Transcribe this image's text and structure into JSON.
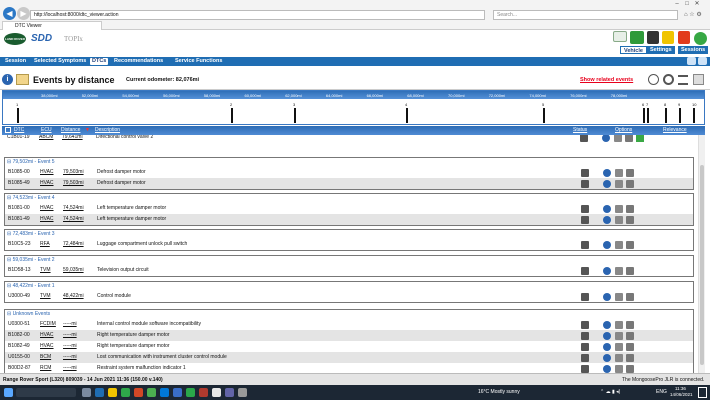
{
  "browser": {
    "url": "http://localhost:8000/dtc_viewer.action",
    "search_placeholder": "Search...",
    "tab_title": "DTC Viewer"
  },
  "app": {
    "logo_text": "LAND ROVER",
    "sdd": "SDD",
    "topix": "TOPIx",
    "top_buttons": [
      "Vehicle",
      "Settings",
      "Sessions"
    ]
  },
  "menu": [
    "Session",
    "Selected Symptoms",
    "DTCs",
    "Recommendations",
    "Service Functions"
  ],
  "events_bar": {
    "title": "Events by distance",
    "odometer": "Current odometer: 82,076mi",
    "related_link": "Show related events"
  },
  "timeline": {
    "ticks": [
      "38,000mi",
      "52,000mi",
      "54,000mi",
      "56,000mi",
      "58,000mi",
      "60,000mi",
      "62,000mi",
      "64,000mi",
      "66,000mi",
      "68,000mi",
      "70,000mi",
      "72,000mi",
      "74,000mi",
      "76,000mi",
      "78,000mi"
    ],
    "markers": [
      {
        "label": "1",
        "pos": 0.02
      },
      {
        "label": "2",
        "pos": 0.325
      },
      {
        "label": "3",
        "pos": 0.415
      },
      {
        "label": "4",
        "pos": 0.575
      },
      {
        "label": "5",
        "pos": 0.77
      },
      {
        "label": "6",
        "pos": 0.913
      },
      {
        "label": "7",
        "pos": 0.918
      },
      {
        "label": "8",
        "pos": 0.945
      },
      {
        "label": "9",
        "pos": 0.965
      },
      {
        "label": "10",
        "pos": 0.985
      }
    ]
  },
  "columns": {
    "dtc": "DTC",
    "ecu": "ECU",
    "distance": "Distance",
    "description": "Description",
    "status": "Status",
    "options": "Options",
    "relevance": "Relevance"
  },
  "top_row": {
    "dtc": "C1B01-19",
    "ecu": "ABCM",
    "distance": "79,641mi",
    "description": "Directional control valve 2"
  },
  "groups": [
    {
      "header": "79,502mi - Event 5",
      "rows": [
        {
          "dtc": "B1085-00",
          "ecu": "HVAC",
          "distance": "79,503mi",
          "description": "Defrost damper motor"
        },
        {
          "dtc": "B1085-49",
          "ecu": "HVAC",
          "distance": "79,503mi",
          "description": "Defrost damper motor"
        }
      ]
    },
    {
      "header": "74,523mi - Event 4",
      "rows": [
        {
          "dtc": "B1081-00",
          "ecu": "HVAC",
          "distance": "74,524mi",
          "description": "Left temperature damper motor"
        },
        {
          "dtc": "B1081-49",
          "ecu": "HVAC",
          "distance": "74,524mi",
          "description": "Left temperature damper motor"
        }
      ]
    },
    {
      "header": "72,483mi - Event 3",
      "rows": [
        {
          "dtc": "B10C5-23",
          "ecu": "RFA",
          "distance": "72,484mi",
          "description": "Luggage compartment unlock pull switch"
        }
      ]
    },
    {
      "header": "59,035mi - Event 2",
      "rows": [
        {
          "dtc": "B1D58-13",
          "ecu": "TVM",
          "distance": "59,035mi",
          "description": "Television output circuit"
        }
      ]
    },
    {
      "header": "48,422mi - Event 1",
      "rows": [
        {
          "dtc": "U3000-49",
          "ecu": "TVM",
          "distance": "48,422mi",
          "description": "Control module"
        }
      ]
    },
    {
      "header": "Unknown Events",
      "rows": [
        {
          "dtc": "U0300-51",
          "ecu": "FCDIM",
          "distance": "-----mi",
          "description": "Internal control module software incompatibility"
        },
        {
          "dtc": "B1082-00",
          "ecu": "HVAC",
          "distance": "-----mi",
          "description": "Right temperature damper motor"
        },
        {
          "dtc": "B1082-49",
          "ecu": "HVAC",
          "distance": "-----mi",
          "description": "Right temperature damper motor"
        },
        {
          "dtc": "U0155-00",
          "ecu": "BCM",
          "distance": "-----mi",
          "description": "Lost communication with instrument cluster control module"
        },
        {
          "dtc": "B00D2-87",
          "ecu": "RCM",
          "distance": "-----mi",
          "description": "Restraint system malfunction indicator 1"
        }
      ]
    }
  ],
  "status_bar": {
    "left": "Range Rover Sport (L320) 809039 - 14 Jun 2021 11:36 (150.00 v.140)",
    "right": "The MongoosePro JLR is connected."
  },
  "taskbar": {
    "weather": "16°C  Mostly sunny",
    "lang": "ENG",
    "time": "11:36",
    "date": "14/06/2021"
  },
  "colors": {
    "accent": "#1f6db3",
    "link": "#e8001c",
    "group_text": "#2a64b0"
  }
}
